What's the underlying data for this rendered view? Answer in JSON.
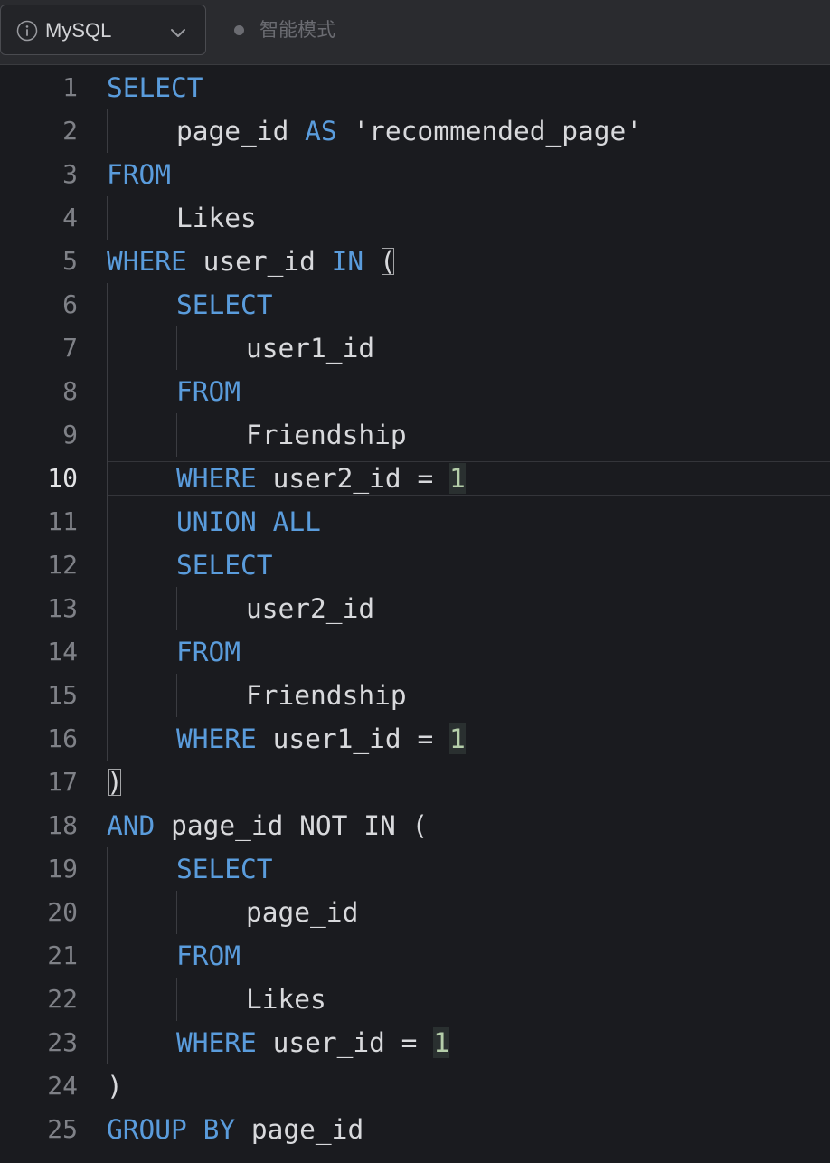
{
  "toolbar": {
    "language": "MySQL",
    "info_icon": "info-circle-icon",
    "dropdown_icon": "chevron-down-icon",
    "mode_label": "智能模式"
  },
  "colors": {
    "keyword": "#5a9cdc",
    "identifier": "#d8d9dc",
    "number": "#b5ceaa",
    "line_number": "#7f8187",
    "line_number_active": "#e3e4e6",
    "background": "#1a1b1f",
    "toolbar_background": "#2a2b2f"
  },
  "editor": {
    "active_line": 10,
    "lines": [
      {
        "n": "1",
        "indent": 0,
        "tokens": [
          {
            "t": "SELECT",
            "k": "keyword"
          }
        ]
      },
      {
        "n": "2",
        "indent": 1,
        "tokens": [
          {
            "t": "page_id",
            "k": "ident"
          },
          {
            "t": " "
          },
          {
            "t": "AS",
            "k": "keyword"
          },
          {
            "t": " "
          },
          {
            "t": "'recommended_page'",
            "k": "string"
          }
        ]
      },
      {
        "n": "3",
        "indent": 0,
        "tokens": [
          {
            "t": "FROM",
            "k": "keyword"
          }
        ]
      },
      {
        "n": "4",
        "indent": 1,
        "tokens": [
          {
            "t": "Likes",
            "k": "ident"
          }
        ]
      },
      {
        "n": "5",
        "indent": 0,
        "tokens": [
          {
            "t": "WHERE",
            "k": "keyword"
          },
          {
            "t": " "
          },
          {
            "t": "user_id",
            "k": "ident"
          },
          {
            "t": " "
          },
          {
            "t": "IN",
            "k": "keyword"
          },
          {
            "t": " "
          },
          {
            "t": "(",
            "k": "punct",
            "m": true
          }
        ]
      },
      {
        "n": "6",
        "indent": 1,
        "tokens": [
          {
            "t": "SELECT",
            "k": "keyword"
          }
        ]
      },
      {
        "n": "7",
        "indent": 2,
        "tokens": [
          {
            "t": "user1_id",
            "k": "ident"
          }
        ]
      },
      {
        "n": "8",
        "indent": 1,
        "tokens": [
          {
            "t": "FROM",
            "k": "keyword"
          }
        ]
      },
      {
        "n": "9",
        "indent": 2,
        "tokens": [
          {
            "t": "Friendship",
            "k": "ident"
          }
        ]
      },
      {
        "n": "10",
        "indent": 1,
        "tokens": [
          {
            "t": "WHERE",
            "k": "keyword"
          },
          {
            "t": " "
          },
          {
            "t": "user2_id",
            "k": "ident"
          },
          {
            "t": " "
          },
          {
            "t": "=",
            "k": "punct"
          },
          {
            "t": " "
          },
          {
            "t": "1",
            "k": "number"
          }
        ]
      },
      {
        "n": "11",
        "indent": 1,
        "tokens": [
          {
            "t": "UNION",
            "k": "keyword"
          },
          {
            "t": " "
          },
          {
            "t": "ALL",
            "k": "keyword"
          }
        ]
      },
      {
        "n": "12",
        "indent": 1,
        "tokens": [
          {
            "t": "SELECT",
            "k": "keyword"
          }
        ]
      },
      {
        "n": "13",
        "indent": 2,
        "tokens": [
          {
            "t": "user2_id",
            "k": "ident"
          }
        ]
      },
      {
        "n": "14",
        "indent": 1,
        "tokens": [
          {
            "t": "FROM",
            "k": "keyword"
          }
        ]
      },
      {
        "n": "15",
        "indent": 2,
        "tokens": [
          {
            "t": "Friendship",
            "k": "ident"
          }
        ]
      },
      {
        "n": "16",
        "indent": 1,
        "tokens": [
          {
            "t": "WHERE",
            "k": "keyword"
          },
          {
            "t": " "
          },
          {
            "t": "user1_id",
            "k": "ident"
          },
          {
            "t": " "
          },
          {
            "t": "=",
            "k": "punct"
          },
          {
            "t": " "
          },
          {
            "t": "1",
            "k": "number"
          }
        ]
      },
      {
        "n": "17",
        "indent": 0,
        "tokens": [
          {
            "t": ")",
            "k": "punct",
            "m": true
          }
        ]
      },
      {
        "n": "18",
        "indent": 0,
        "tokens": [
          {
            "t": "AND",
            "k": "keyword"
          },
          {
            "t": " "
          },
          {
            "t": "page_id",
            "k": "ident"
          },
          {
            "t": " "
          },
          {
            "t": "NOT",
            "k": "ident"
          },
          {
            "t": " "
          },
          {
            "t": "IN",
            "k": "ident"
          },
          {
            "t": " "
          },
          {
            "t": "(",
            "k": "punct"
          }
        ]
      },
      {
        "n": "19",
        "indent": 1,
        "tokens": [
          {
            "t": "SELECT",
            "k": "keyword"
          }
        ]
      },
      {
        "n": "20",
        "indent": 2,
        "tokens": [
          {
            "t": "page_id",
            "k": "ident"
          }
        ]
      },
      {
        "n": "21",
        "indent": 1,
        "tokens": [
          {
            "t": "FROM",
            "k": "keyword"
          }
        ]
      },
      {
        "n": "22",
        "indent": 2,
        "tokens": [
          {
            "t": "Likes",
            "k": "ident"
          }
        ]
      },
      {
        "n": "23",
        "indent": 1,
        "tokens": [
          {
            "t": "WHERE",
            "k": "keyword"
          },
          {
            "t": " "
          },
          {
            "t": "user_id",
            "k": "ident"
          },
          {
            "t": " "
          },
          {
            "t": "=",
            "k": "punct"
          },
          {
            "t": " "
          },
          {
            "t": "1",
            "k": "number"
          }
        ]
      },
      {
        "n": "24",
        "indent": 0,
        "tokens": [
          {
            "t": ")",
            "k": "punct"
          }
        ]
      },
      {
        "n": "25",
        "indent": 0,
        "tokens": [
          {
            "t": "GROUP",
            "k": "keyword"
          },
          {
            "t": " "
          },
          {
            "t": "BY",
            "k": "keyword"
          },
          {
            "t": " "
          },
          {
            "t": "page_id",
            "k": "ident"
          }
        ]
      }
    ]
  }
}
